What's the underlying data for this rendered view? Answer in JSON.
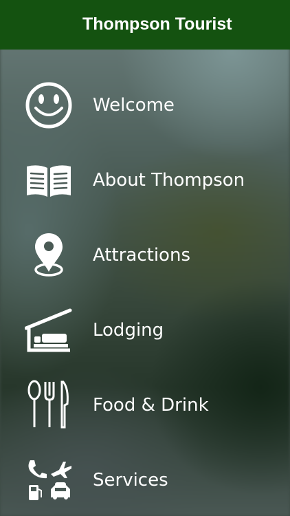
{
  "header": {
    "title": "Thompson Tourist"
  },
  "menu": {
    "items": [
      {
        "label": "Welcome",
        "icon": "smiley-icon"
      },
      {
        "label": "About Thompson",
        "icon": "open-book-icon"
      },
      {
        "label": "Attractions",
        "icon": "map-pin-icon"
      },
      {
        "label": "Lodging",
        "icon": "bed-icon"
      },
      {
        "label": "Food & Drink",
        "icon": "cutlery-icon"
      },
      {
        "label": "Services",
        "icon": "services-icon"
      }
    ]
  },
  "colors": {
    "header_bg": "#145210",
    "text": "#ffffff"
  }
}
